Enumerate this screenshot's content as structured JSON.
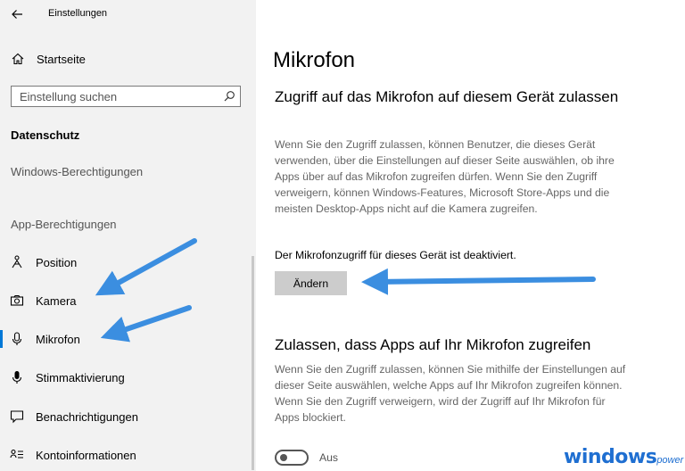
{
  "window": {
    "title": "Einstellungen"
  },
  "sidebar": {
    "home_label": "Startseite",
    "search_placeholder": "Einstellung suchen",
    "section_title": "Datenschutz",
    "windows_permissions": "Windows-Berechtigungen",
    "app_permissions": "App-Berechtigungen",
    "items": [
      {
        "label": "Position",
        "icon": "person-icon"
      },
      {
        "label": "Kamera",
        "icon": "camera-icon"
      },
      {
        "label": "Mikrofon",
        "icon": "microphone-icon",
        "selected": true
      },
      {
        "label": "Stimmaktivierung",
        "icon": "microphone-filled-icon"
      },
      {
        "label": "Benachrichtigungen",
        "icon": "notification-icon"
      },
      {
        "label": "Kontoinformationen",
        "icon": "account-info-icon"
      }
    ]
  },
  "content": {
    "title": "Mikrofon",
    "section1": {
      "heading": "Zugriff auf das Mikrofon auf diesem Gerät zulassen",
      "description": "Wenn Sie den Zugriff zulassen, können Benutzer, die dieses Gerät verwenden, über die Einstellungen auf dieser Seite auswählen, ob ihre Apps über auf das Mikrofon zugreifen dürfen. Wenn Sie den Zugriff verweigern, können Windows-Features, Microsoft Store-Apps und die meisten Desktop-Apps nicht auf die Kamera zugreifen.",
      "status": "Der Mikrofonzugriff für dieses Gerät ist deaktiviert.",
      "button_label": "Ändern"
    },
    "section2": {
      "heading": "Zulassen, dass Apps auf Ihr Mikrofon zugreifen",
      "description": "Wenn Sie den Zugriff zulassen, können Sie mithilfe der Einstellungen auf dieser Seite auswählen, welche Apps auf Ihr Mikrofon zugreifen können. Wenn Sie den Zugriff verweigern, wird der Zugriff auf Ihr Mikrofon für Apps blockiert.",
      "toggle_label": "Aus",
      "toggle_on": false
    }
  },
  "watermark": {
    "main": "windows",
    "sub": "power"
  },
  "colors": {
    "sidebar_bg": "#f2f2f2",
    "accent": "#0078d7",
    "arrow": "#3b8ee0",
    "button_bg": "#cccccc"
  }
}
